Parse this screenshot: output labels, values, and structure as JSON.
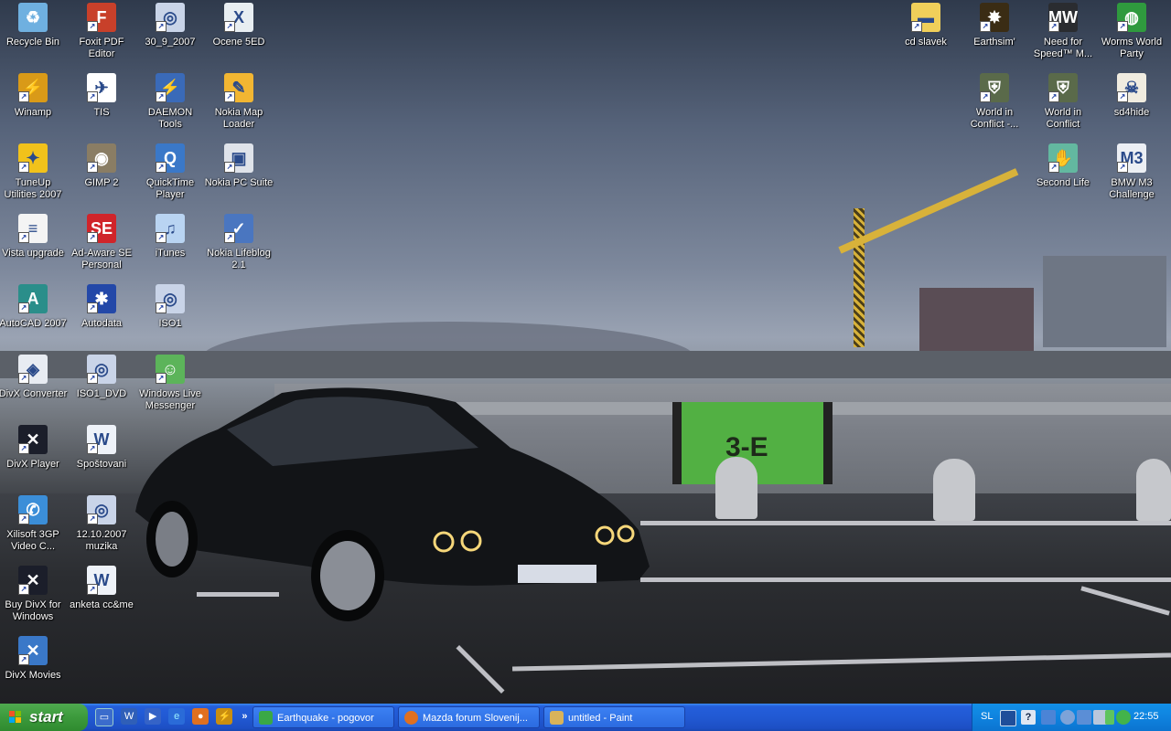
{
  "desktop": {
    "left_icons": [
      {
        "label": "Recycle Bin",
        "icon": "recycle-bin-icon"
      },
      {
        "label": "Foxit PDF Editor",
        "icon": "foxit-pdf-icon"
      },
      {
        "label": "30_9_2007",
        "icon": "disc-image-icon"
      },
      {
        "label": "Ocene 5ED",
        "icon": "excel-file-icon"
      },
      {
        "label": "Winamp",
        "icon": "winamp-icon"
      },
      {
        "label": "TIS",
        "icon": "tis-icon"
      },
      {
        "label": "DAEMON Tools",
        "icon": "daemon-tools-icon"
      },
      {
        "label": "Nokia Map Loader",
        "icon": "nokia-map-icon"
      },
      {
        "label": "TuneUp Utilities 2007",
        "icon": "tuneup-icon"
      },
      {
        "label": "GIMP 2",
        "icon": "gimp-icon"
      },
      {
        "label": "QuickTime Player",
        "icon": "quicktime-icon"
      },
      {
        "label": "Nokia PC Suite",
        "icon": "nokia-pc-suite-icon"
      },
      {
        "label": "Vista upgrade",
        "icon": "text-file-icon"
      },
      {
        "label": "Ad-Aware SE Personal",
        "icon": "ad-aware-icon"
      },
      {
        "label": "iTunes",
        "icon": "itunes-icon"
      },
      {
        "label": "Nokia Lifeblog 2.1",
        "icon": "nokia-lifeblog-icon"
      },
      {
        "label": "AutoCAD 2007",
        "icon": "autocad-icon"
      },
      {
        "label": "Autodata",
        "icon": "autodata-icon"
      },
      {
        "label": "ISO1",
        "icon": "disc-image-icon"
      },
      {
        "label": "DivX Converter",
        "icon": "divx-converter-icon"
      },
      {
        "label": "ISO1_DVD",
        "icon": "disc-image-icon"
      },
      {
        "label": "Windows Live Messenger",
        "icon": "messenger-icon"
      },
      {
        "label": "DivX Player",
        "icon": "divx-player-icon"
      },
      {
        "label": "Spoštovani",
        "icon": "word-file-icon"
      },
      {
        "label": "Xilisoft 3GP Video C...",
        "icon": "xilisoft-icon"
      },
      {
        "label": "12.10.2007 muzika",
        "icon": "disc-image-icon"
      },
      {
        "label": "Buy DivX for Windows",
        "icon": "divx-buy-icon"
      },
      {
        "label": "anketa cc&me",
        "icon": "word-file-icon"
      },
      {
        "label": "DivX Movies",
        "icon": "divx-movies-icon"
      }
    ],
    "right_icons": [
      {
        "label": "cd slavek",
        "icon": "folder-icon"
      },
      {
        "label": "Earthsim'",
        "icon": "earthsim-icon"
      },
      {
        "label": "Need for Speed™ M...",
        "icon": "nfs-icon"
      },
      {
        "label": "Worms World Party",
        "icon": "worms-icon"
      },
      {
        "label": "World in Conflict -...",
        "icon": "world-in-conflict-icon"
      },
      {
        "label": "World in Conflict",
        "icon": "world-in-conflict-icon"
      },
      {
        "label": "sd4hide",
        "icon": "skull-icon"
      },
      {
        "label": "Second Life",
        "icon": "second-life-icon"
      },
      {
        "label": "BMW M3 Challenge",
        "icon": "bmw-m3-icon"
      }
    ],
    "wallpaper_sign": "3-E"
  },
  "taskbar": {
    "start_label": "start",
    "quick_launch": [
      "show-desktop-icon",
      "word-icon",
      "media-player-icon",
      "ie-icon",
      "firefox-icon",
      "winamp-icon"
    ],
    "quick_launch_more": "»",
    "windows": [
      {
        "title": "Earthquake - pogovor",
        "icon": "messenger-icon"
      },
      {
        "title": "Mazda forum Slovenij...",
        "icon": "firefox-icon"
      },
      {
        "title": "untitled - Paint",
        "icon": "paint-icon"
      }
    ],
    "tray": {
      "language": "SL",
      "icons": [
        "network-icon",
        "help-icon",
        "safely-remove-icon",
        "back-arrow-icon",
        "monitor-icon",
        "volume-icon",
        "battery-icon",
        "messenger-icon"
      ],
      "clock": "22:55"
    }
  },
  "colors": {
    "taskbar": "#245edb",
    "start": "#3c9a3c",
    "tray": "#0f83df"
  }
}
